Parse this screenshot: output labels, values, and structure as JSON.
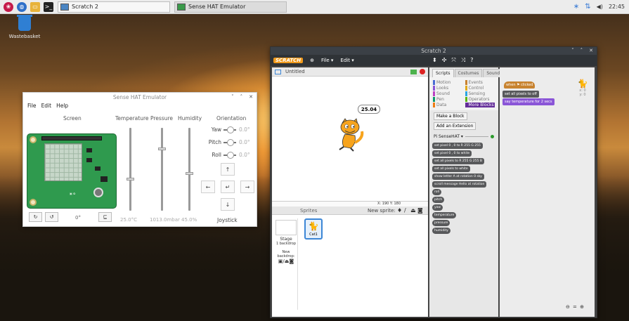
{
  "taskbar": {
    "tasks": [
      {
        "label": "Scratch 2"
      },
      {
        "label": "Sense HAT Emulator"
      }
    ],
    "clock": "22:45"
  },
  "desktop": {
    "wastebasket_label": "Wastebasket"
  },
  "sense_hat": {
    "title": "Sense HAT Emulator",
    "menu": [
      "File",
      "Edit",
      "Help"
    ],
    "columns": {
      "screen": "Screen",
      "temperature": "Temperature",
      "pressure": "Pressure",
      "humidity": "Humidity",
      "orientation": "Orientation"
    },
    "orientation": [
      {
        "label": "Yaw",
        "value": "0.0°"
      },
      {
        "label": "Pitch",
        "value": "0.0°"
      },
      {
        "label": "Roll",
        "value": "0.0°"
      }
    ],
    "joystick_label": "Joystick",
    "joystick": {
      "up": "↑",
      "left": "←",
      "center": "↵",
      "right": "→",
      "down": "↓"
    },
    "readings": {
      "temperature": "25.0°C",
      "pressure": "1013.0mbar",
      "humidity": "45.0%"
    },
    "rotation_value": "0°",
    "rotate_left": "↻",
    "rotate_right": "↺",
    "extra_button": "⊑"
  },
  "scratch": {
    "title": "Scratch 2",
    "logo": "SCRATCH",
    "menu": [
      "File ▾",
      "Edit ▾"
    ],
    "project_name": "Untitled",
    "speech_bubble": "25.04",
    "coords": "X: 190  Y: 180",
    "sprites_label": "Sprites",
    "new_sprite_label": "New sprite:",
    "stage_label": "Stage",
    "stage_backdrops": "1 backdrop",
    "new_backdrop": "New backdrop:",
    "sprite_name": "Cat1",
    "tabs": [
      "Scripts",
      "Costumes",
      "Sounds"
    ],
    "categories": [
      {
        "name": "Motion",
        "color": "#4a6cd4"
      },
      {
        "name": "Events",
        "color": "#c88330"
      },
      {
        "name": "Looks",
        "color": "#8a55d7"
      },
      {
        "name": "Control",
        "color": "#e1a91a"
      },
      {
        "name": "Sound",
        "color": "#bb42c3"
      },
      {
        "name": "Sensing",
        "color": "#2ca5e2"
      },
      {
        "name": "Pen",
        "color": "#0e9a6c"
      },
      {
        "name": "Operators",
        "color": "#5cb712"
      },
      {
        "name": "Data",
        "color": "#ee7d16"
      },
      {
        "name": "More Blocks",
        "color": "#632d99"
      }
    ],
    "make_block": "Make a Block",
    "add_extension": "Add an Extension",
    "extension_name": "Pi SenseHAT ▾",
    "blocks": [
      "set pixel 0 , 0 to R 255 G 255",
      "set pixel 0 , 0 to white",
      "set all pixels to R 255 G 255 B",
      "set all pixels to white",
      "show letter A at rotation 0  sky",
      "scroll message Hello at rotation",
      "roll",
      "pitch",
      "yaw",
      "temperature",
      "pressure",
      "humidity"
    ],
    "script": {
      "hat": "when ⚑ clicked",
      "set_all": "set all pixels to off",
      "say": "say temperature for 2 secs"
    },
    "sprite_xy": "x: 0\ny: 0",
    "zoom": "⊖ = ⊕"
  }
}
